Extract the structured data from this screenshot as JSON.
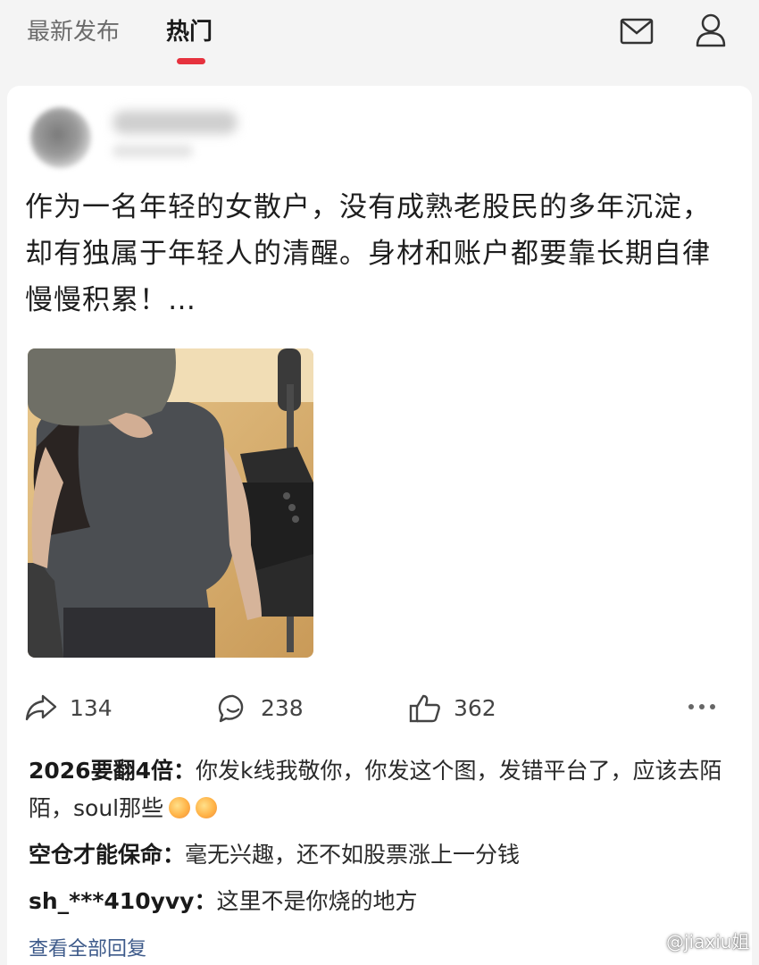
{
  "tabs": [
    {
      "label": "最新发布",
      "active": false
    },
    {
      "label": "热门",
      "active": true
    }
  ],
  "accent_color": "#e6323e",
  "top_icons": [
    "mail-icon",
    "user-icon"
  ],
  "post": {
    "text": "作为一名年轻的女散户，没有成熟老股民的多年沉淀，却有独属于年轻人的清醒。身材和账户都要靠长期自律慢慢积累！…",
    "actions": {
      "share_count": "134",
      "comment_count": "238",
      "like_count": "362"
    }
  },
  "comments": [
    {
      "name": "2026要翻4倍：",
      "text": "你发k线我敬你，你发这个图，发错平台了，应该去陌陌，soul那些",
      "emoji_count": 2
    },
    {
      "name": "空仓才能保命：",
      "text": "毫无兴趣，还不如股票涨上一分钱"
    },
    {
      "name": "sh_***410yvy：",
      "text": "这里不是你烧的地方"
    }
  ],
  "view_all_label": "查看全部回复",
  "watermark": "@jiaxiu姐"
}
